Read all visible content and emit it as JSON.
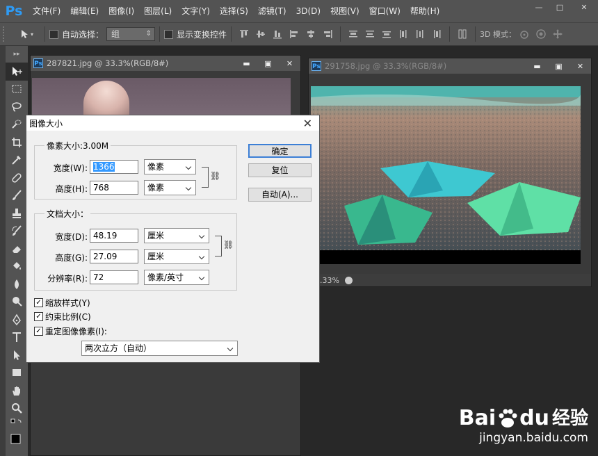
{
  "app": {
    "logo": "Ps"
  },
  "menu": [
    "文件(F)",
    "编辑(E)",
    "图像(I)",
    "图层(L)",
    "文字(Y)",
    "选择(S)",
    "滤镜(T)",
    "3D(D)",
    "视图(V)",
    "窗口(W)",
    "帮助(H)"
  ],
  "window_controls": {
    "minimize": "—",
    "restore": "□",
    "close": "✕"
  },
  "options": {
    "auto_select_label": "自动选择：",
    "auto_select_value": "组",
    "show_transform_label": "显示变换控件",
    "mode_3d_label": "3D 模式："
  },
  "doc1": {
    "title": "287821.jpg @ 33.3%(RGB/8#)",
    "badge": "Ps"
  },
  "doc2": {
    "title": "291758.jpg @ 33.3%(RGB/8#)",
    "badge": "Ps",
    "zoom": "33.33%"
  },
  "dialog": {
    "title": "图像大小",
    "close": "✕",
    "pixel_group": "像素大小:3.00M",
    "width_label": "宽度(W):",
    "width_value": "1366",
    "width_unit": "像素",
    "height_label": "高度(H):",
    "height_value": "768",
    "height_unit": "像素",
    "doc_group": "文档大小：",
    "doc_width_label": "宽度(D):",
    "doc_width_value": "48.19",
    "doc_width_unit": "厘米",
    "doc_height_label": "高度(G):",
    "doc_height_value": "27.09",
    "doc_height_unit": "厘米",
    "res_label": "分辨率(R):",
    "res_value": "72",
    "res_unit": "像素/英寸",
    "scale_styles": "缩放样式(Y)",
    "constrain": "约束比例(C)",
    "resample": "重定图像像素(I):",
    "resample_method": "两次立方（自动）",
    "ok": "确定",
    "reset": "复位",
    "auto": "自动(A)..."
  },
  "watermark": {
    "brand": "Bai",
    "brand2": "du",
    "suffix": "经验",
    "url": "jingyan.baidu.com"
  }
}
